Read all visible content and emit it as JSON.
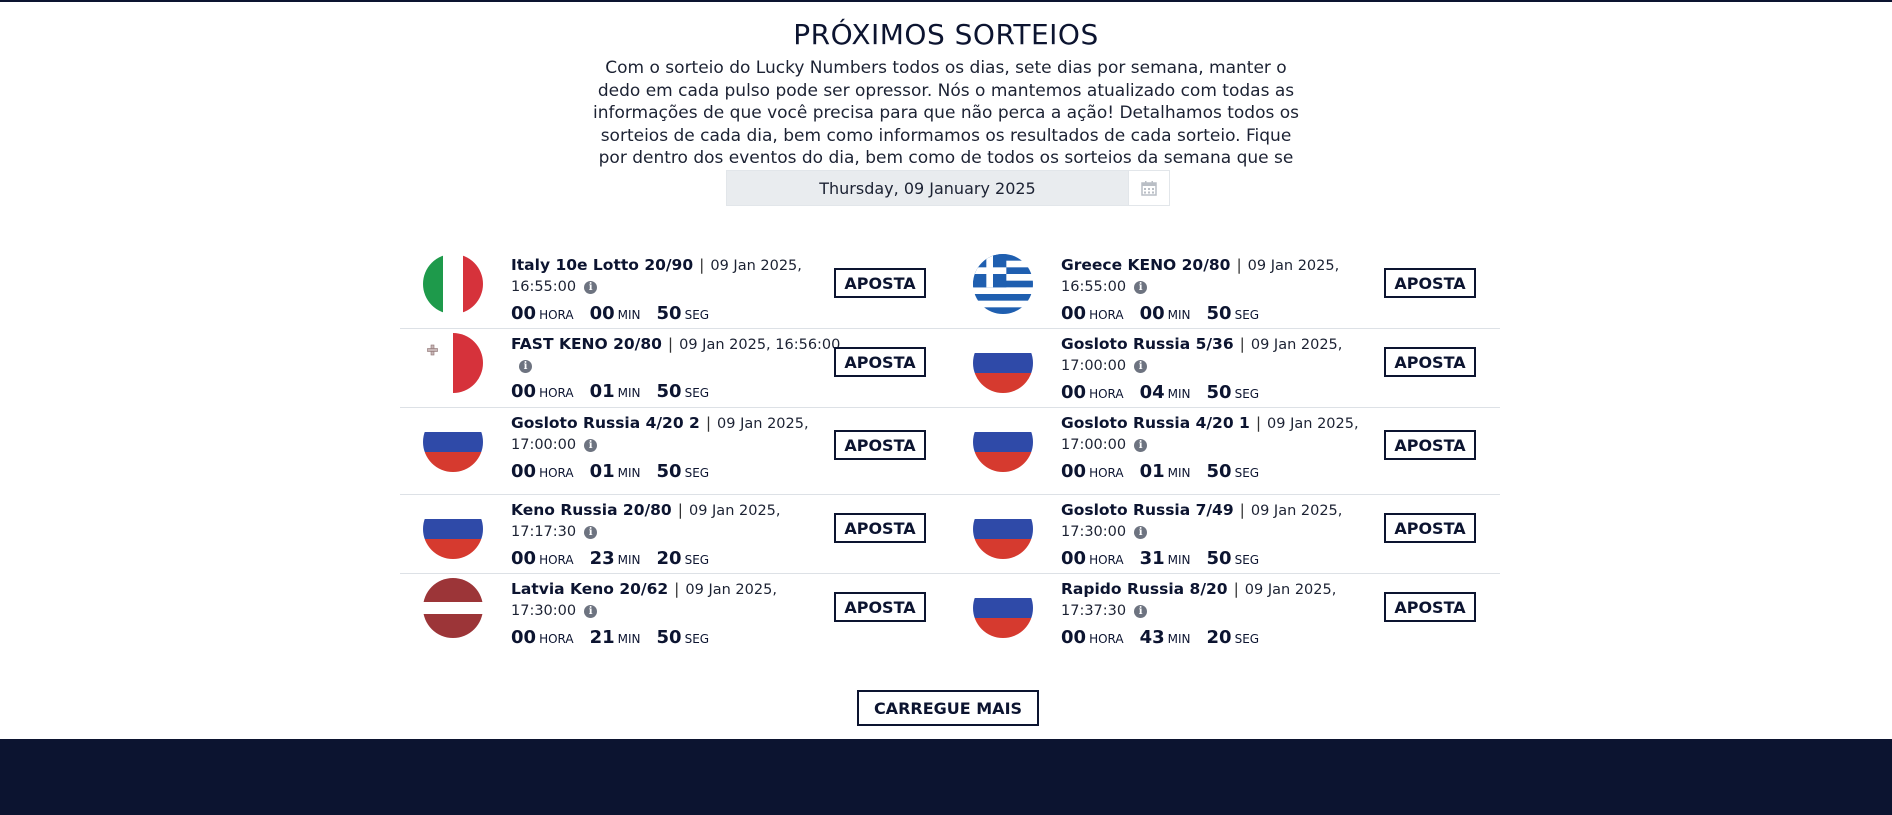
{
  "header": {
    "title": "PRÓXIMOS SORTEIOS",
    "description": "Com o sorteio do Lucky Numbers todos os dias, sete dias por semana, manter o dedo em cada pulso pode ser opressor. Nós o mantemos atualizado com todas as informações de que você precisa para que não perca a ação! Detalhamos todos os sorteios de cada dia, bem como informamos os resultados de cada sorteio. Fique por dentro dos eventos do dia, bem como de todos os sorteios da semana que se inicia!"
  },
  "date_picker": {
    "value": "Thursday, 09 January 2025",
    "icon": "calendar-icon"
  },
  "labels": {
    "hora": "HORA",
    "min": "MIN",
    "seg": "SEG",
    "bet": "APOSTA",
    "info_icon": "info-icon"
  },
  "draws": [
    {
      "name": "Italy 10e Lotto 20/90",
      "datetime": "09 Jan 2025, 16:55:00",
      "h": "00",
      "m": "00",
      "s": "50",
      "flag": "italy"
    },
    {
      "name": "Greece KENO 20/80",
      "datetime": "09 Jan 2025, 16:55:00",
      "h": "00",
      "m": "00",
      "s": "50",
      "flag": "greece"
    },
    {
      "name": "FAST KENO 20/80",
      "datetime": "09 Jan 2025, 16:56:00",
      "h": "00",
      "m": "01",
      "s": "50",
      "flag": "malta"
    },
    {
      "name": "Gosloto Russia 5/36",
      "datetime": "09 Jan 2025, 17:00:00",
      "h": "00",
      "m": "04",
      "s": "50",
      "flag": "russia"
    },
    {
      "name": "Gosloto Russia 4/20 2",
      "datetime": "09 Jan 2025, 17:00:00",
      "h": "00",
      "m": "01",
      "s": "50",
      "flag": "russia"
    },
    {
      "name": "Gosloto Russia 4/20 1",
      "datetime": "09 Jan 2025, 17:00:00",
      "h": "00",
      "m": "01",
      "s": "50",
      "flag": "russia"
    },
    {
      "name": "Keno Russia 20/80",
      "datetime": "09 Jan 2025, 17:17:30",
      "h": "00",
      "m": "23",
      "s": "20",
      "flag": "russia"
    },
    {
      "name": "Gosloto Russia 7/49",
      "datetime": "09 Jan 2025, 17:30:00",
      "h": "00",
      "m": "31",
      "s": "50",
      "flag": "russia"
    },
    {
      "name": "Latvia Keno 20/62",
      "datetime": "09 Jan 2025, 17:30:00",
      "h": "00",
      "m": "21",
      "s": "50",
      "flag": "latvia"
    },
    {
      "name": "Rapido Russia 8/20",
      "datetime": "09 Jan 2025, 17:37:30",
      "h": "00",
      "m": "43",
      "s": "20",
      "flag": "russia"
    }
  ],
  "load_more": "CARREGUE MAIS",
  "colors": {
    "navy": "#0c1430",
    "russia_blue": "#2f4aa8",
    "russia_red": "#d63a2f",
    "italy_green": "#1e9a4b",
    "italy_red": "#d6323b",
    "greece_blue": "#1f5fb0",
    "latvia_red": "#9c3538",
    "malta_red": "#d6323b"
  }
}
